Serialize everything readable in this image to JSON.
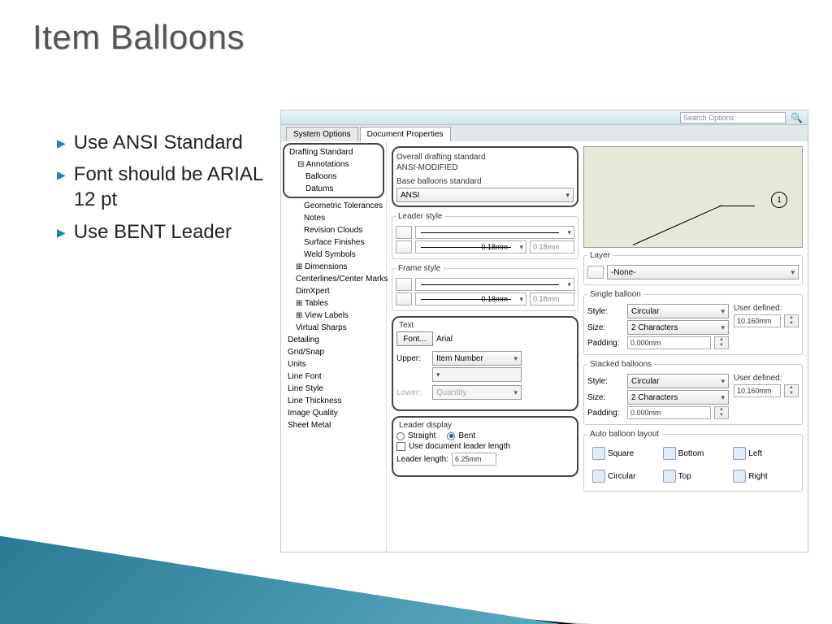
{
  "title": "Item Balloons",
  "bullets": [
    "Use ANSI Standard",
    "Font should be ARIAL 12 pt",
    "Use BENT Leader"
  ],
  "tabs": {
    "system": "System Options",
    "document": "Document Properties"
  },
  "search_placeholder": "Search Options",
  "tree": {
    "root": "Drafting Standard",
    "annotations": "Annotations",
    "anno_children": [
      "Balloons",
      "Datums",
      "Geometric Tolerances",
      "Notes",
      "Revision Clouds",
      "Surface Finishes",
      "Weld Symbols"
    ],
    "dimensions": "Dimensions",
    "centerlines": "Centerlines/Center Marks",
    "dimxpert": "DimXpert",
    "tables": "Tables",
    "viewlabels": "View Labels",
    "virtualsharps": "Virtual Sharps",
    "rest": [
      "Detailing",
      "Grid/Snap",
      "Units",
      "Line Font",
      "Line Style",
      "Line Thickness",
      "Image Quality",
      "Sheet Metal"
    ]
  },
  "overall_label": "Overall drafting standard",
  "overall_value": "ANSI-MODIFIED",
  "base_label": "Base balloons standard",
  "base_value": "ANSI",
  "leader_style": "Leader style",
  "frame_style": "Frame style",
  "thin_value": "0.18mm",
  "text": {
    "legend": "Text",
    "font_btn": "Font...",
    "font_name": "Arial",
    "upper_label": "Upper:",
    "upper_value": "Item Number",
    "lower_label": "Lower:",
    "lower_value": "Quantity"
  },
  "leader_display": {
    "legend": "Leader display",
    "straight": "Straight",
    "bent": "Bent",
    "use_doc": "Use document leader length",
    "length_label": "Leader length:",
    "length_value": "6.25mm"
  },
  "layer": {
    "legend": "Layer",
    "value": "-None-"
  },
  "single": {
    "legend": "Single balloon",
    "style_label": "Style:",
    "style_value": "Circular",
    "size_label": "Size:",
    "size_value": "2 Characters",
    "padding_label": "Padding:",
    "padding_value": "0.000mm",
    "userdef_label": "User defined:",
    "userdef_value": "10.160mm"
  },
  "stacked": {
    "legend": "Stacked balloons",
    "style_label": "Style:",
    "style_value": "Circular",
    "size_label": "Size:",
    "size_value": "2 Characters",
    "padding_label": "Padding:",
    "padding_value": "0.000mm",
    "userdef_label": "User defined:",
    "userdef_value": "10.160mm"
  },
  "auto_layout": {
    "legend": "Auto balloon layout",
    "buttons": [
      "Square",
      "Bottom",
      "Left",
      "Circular",
      "Top",
      "Right"
    ]
  },
  "preview_number": "1"
}
